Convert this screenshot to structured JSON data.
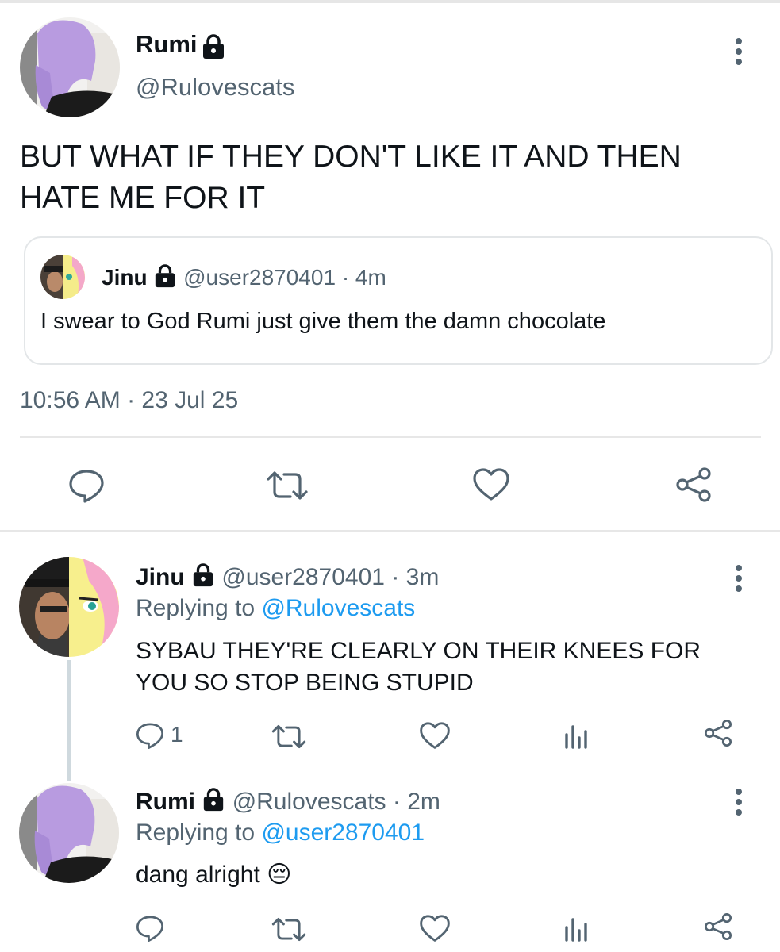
{
  "main_tweet": {
    "author_name": "Rumi",
    "author_handle": "@Rulovescats",
    "text_line1": "BUT WHAT IF THEY DON'T LIKE IT AND THEN",
    "text_line2": "HATE ME FOR IT",
    "timestamp": "10:56 AM · 23 Jul 25",
    "quoted": {
      "author_name": "Jinu",
      "author_handle": "@user2870401",
      "time": "· 4m",
      "text": "I swear to God Rumi just give them the damn chocolate"
    }
  },
  "replies": [
    {
      "author_name": "Jinu",
      "author_handle": "@user2870401",
      "time": "· 3m",
      "replying_prefix": "Replying to",
      "replying_to": "@Rulovescats",
      "text_line1": "SYBAU THEY'RE CLEARLY ON THEIR KNEES FOR",
      "text_line2": "YOU SO STOP BEING STUPID",
      "reply_count": "1"
    },
    {
      "author_name": "Rumi",
      "author_handle": "@Rulovescats",
      "time": "· 2m",
      "replying_prefix": "Replying to",
      "replying_to": "@user2870401",
      "text": "dang alright",
      "emoji": "😔"
    }
  ],
  "icons": {
    "lock": "lock-icon",
    "more": "more-icon",
    "reply": "reply-icon",
    "retweet": "retweet-icon",
    "like": "like-icon",
    "share": "share-icon",
    "analytics": "analytics-icon"
  },
  "colors": {
    "text": "#0f1419",
    "secondary": "#536471",
    "link": "#1d9bf0",
    "divider": "#e7e7e7"
  }
}
